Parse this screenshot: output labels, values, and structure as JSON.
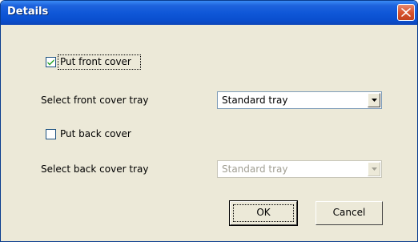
{
  "window": {
    "title": "Details"
  },
  "front_cover": {
    "checkbox_label": "Put front cover",
    "checked": true,
    "tray_label": "Select front cover tray",
    "tray_value": "Standard tray"
  },
  "back_cover": {
    "checkbox_label": "Put back cover",
    "checked": false,
    "tray_label": "Select back cover tray",
    "tray_value": "Standard tray",
    "tray_disabled": true
  },
  "buttons": {
    "ok_label": "OK",
    "cancel_label": "Cancel"
  },
  "colors": {
    "title_bar": "#0f57d8",
    "dialog_face": "#ece9d8",
    "close_button": "#d8532d",
    "disabled_text": "#a19f93"
  },
  "icons": {
    "close": "close-x-icon",
    "check": "checkmark-icon",
    "dropdown": "chevron-down-icon"
  }
}
